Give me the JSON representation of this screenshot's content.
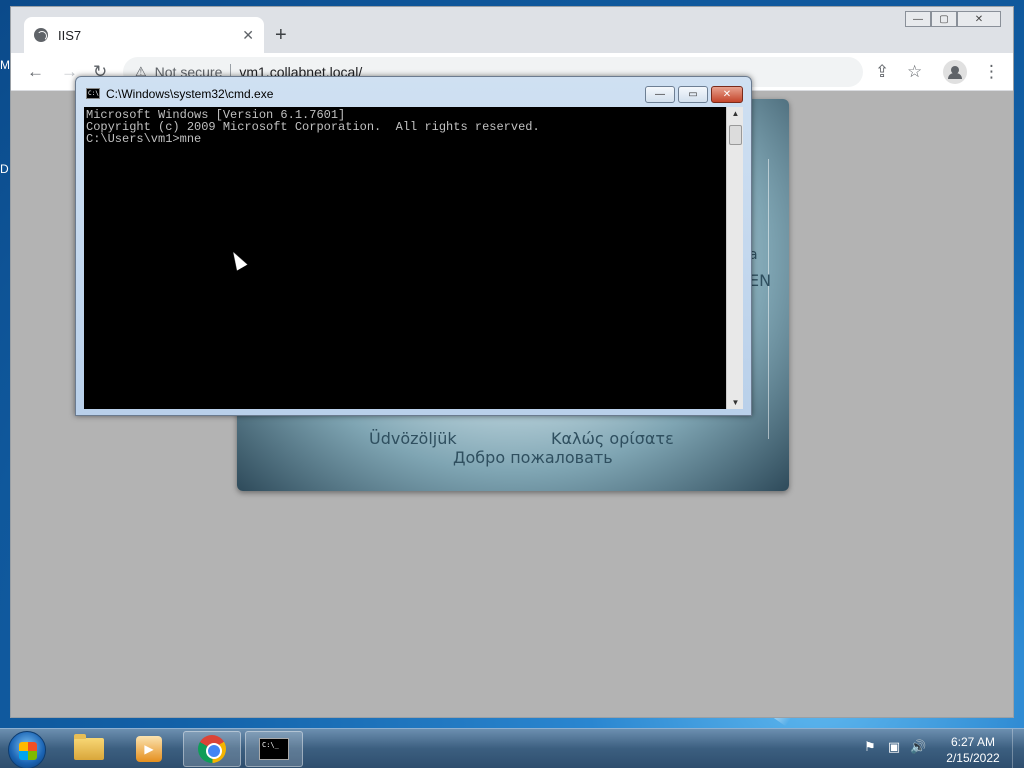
{
  "desktop": {
    "left_letters": [
      "M",
      "D"
    ]
  },
  "browser": {
    "tab_title": "IIS7",
    "tab_close": "✕",
    "new_tab": "+",
    "security_label": "Not secure",
    "url": "vm1.collabnet.local/",
    "window_buttons": {
      "minimize": "—",
      "maximize": "▢",
      "close": "✕"
    },
    "icons": {
      "back": "←",
      "forward": "→",
      "reload": "↻",
      "share": "⇪",
      "bookmark": "☆",
      "menu": "⋮"
    }
  },
  "page": {
    "welcome_words": [
      "Üdvözöljük",
      "Καλώς ορίσατε",
      "Добро пожаловать"
    ],
    "partial_words": [
      "a",
      "EN"
    ]
  },
  "cmd": {
    "title": "C:\\Windows\\system32\\cmd.exe",
    "icon_text": "C:\\",
    "lines": [
      "Microsoft Windows [Version 6.1.7601]",
      "Copyright (c) 2009 Microsoft Corporation.  All rights reserved.",
      "",
      "C:\\Users\\vm1>mne"
    ],
    "buttons": {
      "minimize": "—",
      "maximize": "▭",
      "close": "✕"
    }
  },
  "taskbar": {
    "cmd_icon_text": "C:\\_",
    "clock_time": "6:27 AM",
    "clock_date": "2/15/2022",
    "tray": {
      "action_center": "⚑",
      "network": "▣",
      "volume": "🔊"
    }
  }
}
